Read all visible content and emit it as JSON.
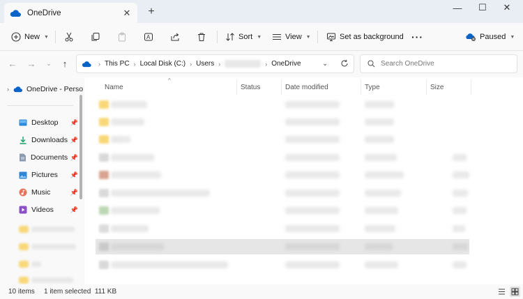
{
  "window": {
    "tab_title": "OneDrive",
    "new_tab": "+",
    "controls": {
      "minimize": "—",
      "maximize": "☐",
      "close": "✕"
    }
  },
  "toolbar": {
    "new_label": "New",
    "sort_label": "Sort",
    "view_label": "View",
    "background_label": "Set as background",
    "more_label": "···",
    "sync_label": "Paused"
  },
  "address": {
    "crumbs": [
      "This PC",
      "Local Disk (C:)",
      "Users",
      "OneDrive"
    ],
    "search_placeholder": "Search OneDrive"
  },
  "nav": {
    "root_label": "OneDrive - Perso",
    "quick_access": [
      {
        "label": "Desktop",
        "icon": "desktop-icon"
      },
      {
        "label": "Downloads",
        "icon": "download-icon"
      },
      {
        "label": "Documents",
        "icon": "documents-icon"
      },
      {
        "label": "Pictures",
        "icon": "pictures-icon"
      },
      {
        "label": "Music",
        "icon": "music-icon"
      },
      {
        "label": "Videos",
        "icon": "videos-icon"
      }
    ]
  },
  "columns": {
    "name": "Name",
    "status": "Status",
    "date": "Date modified",
    "type": "Type",
    "size": "Size"
  },
  "status": {
    "item_count": "10 items",
    "selection": "1 item selected  111 KB"
  },
  "colors": {
    "folder": "#f8d776",
    "accent": "#0a64c8",
    "selected_row": "#e6e6e6"
  }
}
